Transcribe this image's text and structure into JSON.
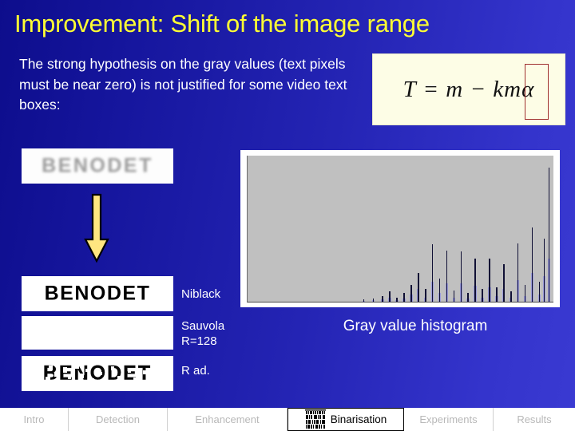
{
  "slide": {
    "title": "Improvement: Shift of the image range",
    "body_text": "The strong hypothesis on the gray values (text pixels must be near zero) is not justified for some video text boxes:",
    "formula_text": "T = m − kmα",
    "formula_highlight": "m",
    "histogram_caption": "Gray value histogram",
    "source_image_text": "BENODET",
    "results": [
      {
        "label": "Niblack",
        "text": "BENODET",
        "style": "clean"
      },
      {
        "label": "Sauvola\nR=128",
        "text": "",
        "style": "blank"
      },
      {
        "label": "R ad.",
        "text": "BENODET",
        "style": "degraded"
      }
    ]
  },
  "colors": {
    "title": "#ffff33",
    "body": "#ffffff",
    "background_left": "#0d0d8c",
    "background_right": "#3a3ad2",
    "formula_box": "#fdfde6",
    "formula_highlight_border": "#a03030",
    "arrow": "#ffe680",
    "histogram_plot_bg": "#c0c0c0",
    "histogram_spike": "#101035",
    "histogram_fill": "#9a9ad8",
    "nav_active_text": "#000000",
    "nav_inactive_text": "#b8b8b8"
  },
  "navbar": {
    "items": [
      {
        "label": "Intro",
        "active": false
      },
      {
        "label": "Detection",
        "active": false
      },
      {
        "label": "Enhancement",
        "active": false
      },
      {
        "label": "Binarisation",
        "active": true
      },
      {
        "label": "Experiments",
        "active": false
      },
      {
        "label": "Results",
        "active": false
      }
    ],
    "active_icon": "barcode-thumbnail-icon"
  },
  "chart_data": {
    "type": "bar",
    "title": "Gray value histogram",
    "xlabel": "",
    "ylabel": "",
    "xlim": [
      0,
      255
    ],
    "ylim": [
      0,
      100
    ],
    "grid": false,
    "legend": false,
    "note": "Counts are empty for low gray values and rise in sharp isolated spikes toward high gray values; text pixels are NOT near zero.",
    "x": [
      96,
      104,
      112,
      118,
      124,
      130,
      136,
      142,
      148,
      154,
      160,
      166,
      172,
      178,
      184,
      190,
      196,
      202,
      208,
      214,
      220,
      226,
      232,
      238,
      244,
      248,
      252
    ],
    "values": [
      1.5,
      2.5,
      4,
      7,
      3,
      6,
      12,
      20,
      9,
      40,
      16,
      36,
      8,
      35,
      6,
      30,
      9,
      30,
      10,
      26,
      7,
      41,
      12,
      52,
      14,
      44,
      94
    ],
    "fill_values": [
      0.5,
      1,
      1.5,
      3,
      1,
      2.5,
      5,
      9,
      3,
      14,
      6,
      13,
      3,
      13,
      2,
      11,
      3,
      10,
      4,
      9,
      3,
      15,
      4,
      20,
      5,
      18,
      30
    ]
  }
}
